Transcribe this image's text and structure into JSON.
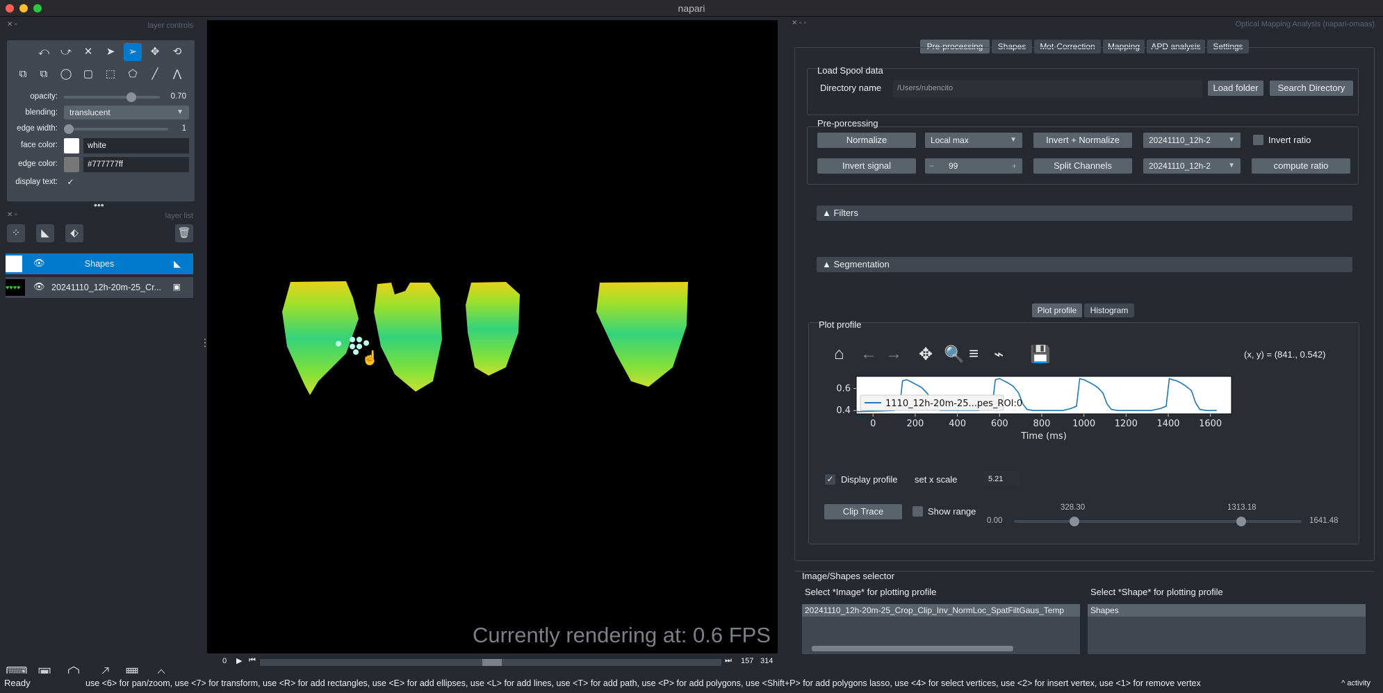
{
  "window": {
    "title": "napari"
  },
  "left": {
    "layer_controls_title": "layer controls",
    "opacity_label": "opacity:",
    "opacity_value": "0.70",
    "opacity_fraction": 0.7,
    "blending_label": "blending:",
    "blending_value": "translucent",
    "edge_width_label": "edge width:",
    "edge_width_value": "1",
    "face_color_label": "face color:",
    "face_color_value": "white",
    "face_color_hex": "#ffffff",
    "edge_color_label": "edge color:",
    "edge_color_value": "#777777ff",
    "edge_color_hex": "#777777",
    "display_text_label": "display text:",
    "layer_list_title": "layer list",
    "layers": [
      {
        "name": "Shapes"
      },
      {
        "name": "20241110_12h-20m-25_Cr..."
      }
    ]
  },
  "canvas": {
    "fps_text": "Currently rendering at: 0.6 FPS"
  },
  "dims": {
    "current": "0",
    "frame": "157",
    "total": "314"
  },
  "right": {
    "panel_title": "Optical Mapping Analysis (napari-omaas)",
    "tabs": [
      "Pre-processing",
      "Shapes",
      "Mot-Correction",
      "Mapping",
      "APD analysis",
      "Settings"
    ],
    "load": {
      "title": "Load Spool data",
      "dir_label": "Directory name",
      "dir_value": "/Users/rubencito",
      "load_btn": "Load folder",
      "search_btn": "Search Directory"
    },
    "prep": {
      "title": "Pre-porcessing",
      "normalize": "Normalize",
      "local_max": "Local max",
      "invert_normalize": "Invert + Normalize",
      "combo1": "20241110_12h-2",
      "invert_ratio": "Invert ratio",
      "invert_signal": "Invert signal",
      "spin_value": "99",
      "spin_minus": "−",
      "spin_plus": "+",
      "split_channels": "Split Channels",
      "combo2": "20241110_12h-2",
      "compute_ratio": "compute ratio"
    },
    "filters": "Filters",
    "segmentation": "Segmentation",
    "plot_tabs": [
      "Plot profile",
      "Histogram"
    ],
    "plot": {
      "title": "Plot profile",
      "coords": "(x, y) = (841., 0.542)",
      "legend": "1110_12h-20m-25...pes_ROI:0",
      "xlabel": "Time (ms)",
      "display_profile": "Display profile",
      "set_x_scale": "set x scale",
      "x_scale_value": "5.21",
      "clip_trace": "Clip Trace",
      "show_range": "Show range",
      "range_min": "0.00",
      "range_max": "1641.48",
      "range_lo": "328.30",
      "range_hi": "1313.18"
    },
    "selector": {
      "title": "Image/Shapes selector",
      "image_label": "Select *Image* for plotting profile",
      "shape_label": "Select *Shape* for plotting profile",
      "image_item": "20241110_12h-20m-25_Crop_Clip_Inv_NormLoc_SpatFiltGaus_Temp",
      "shape_item": "Shapes"
    }
  },
  "chart_data": {
    "type": "line",
    "xlabel": "Time (ms)",
    "ylabel": "",
    "xlim": [
      -80,
      1700
    ],
    "ylim": [
      0.37,
      0.71
    ],
    "xticks": [
      0,
      200,
      400,
      600,
      800,
      1000,
      1200,
      1400,
      1600
    ],
    "yticks": [
      0.4,
      0.6
    ],
    "series": [
      {
        "name": "1110_12h-20m-25...pes_ROI:0",
        "color": "#1f77b4",
        "x": [
          -80,
          100,
          125,
          140,
          160,
          180,
          200,
          230,
          260,
          280,
          300,
          320,
          500,
          540,
          565,
          580,
          600,
          620,
          640,
          665,
          690,
          710,
          730,
          760,
          900,
          940,
          965,
          980,
          1000,
          1020,
          1040,
          1065,
          1090,
          1110,
          1130,
          1160,
          1320,
          1365,
          1390,
          1405,
          1420,
          1440,
          1460,
          1485,
          1510,
          1530,
          1550,
          1580,
          1630
        ],
        "y": [
          0.39,
          0.4,
          0.42,
          0.67,
          0.68,
          0.66,
          0.64,
          0.61,
          0.55,
          0.45,
          0.41,
          0.4,
          0.4,
          0.42,
          0.44,
          0.68,
          0.69,
          0.67,
          0.65,
          0.62,
          0.56,
          0.46,
          0.41,
          0.4,
          0.4,
          0.42,
          0.44,
          0.69,
          0.68,
          0.66,
          0.64,
          0.61,
          0.56,
          0.46,
          0.41,
          0.4,
          0.4,
          0.42,
          0.44,
          0.69,
          0.68,
          0.67,
          0.65,
          0.62,
          0.58,
          0.47,
          0.41,
          0.4,
          0.4
        ]
      }
    ]
  },
  "status": {
    "ready": "Ready",
    "hint": "use <6> for pan/zoom, use <7> for transform, use <R> for add rectangles, use <E> for add ellipses, use <L> for add lines, use <T> for add path, use <P> for add polygons, use <Shift+P> for add polygons lasso, use <4> for select vertices, use <2> for insert vertex, use <1> for remove vertex",
    "activity": "activity"
  }
}
